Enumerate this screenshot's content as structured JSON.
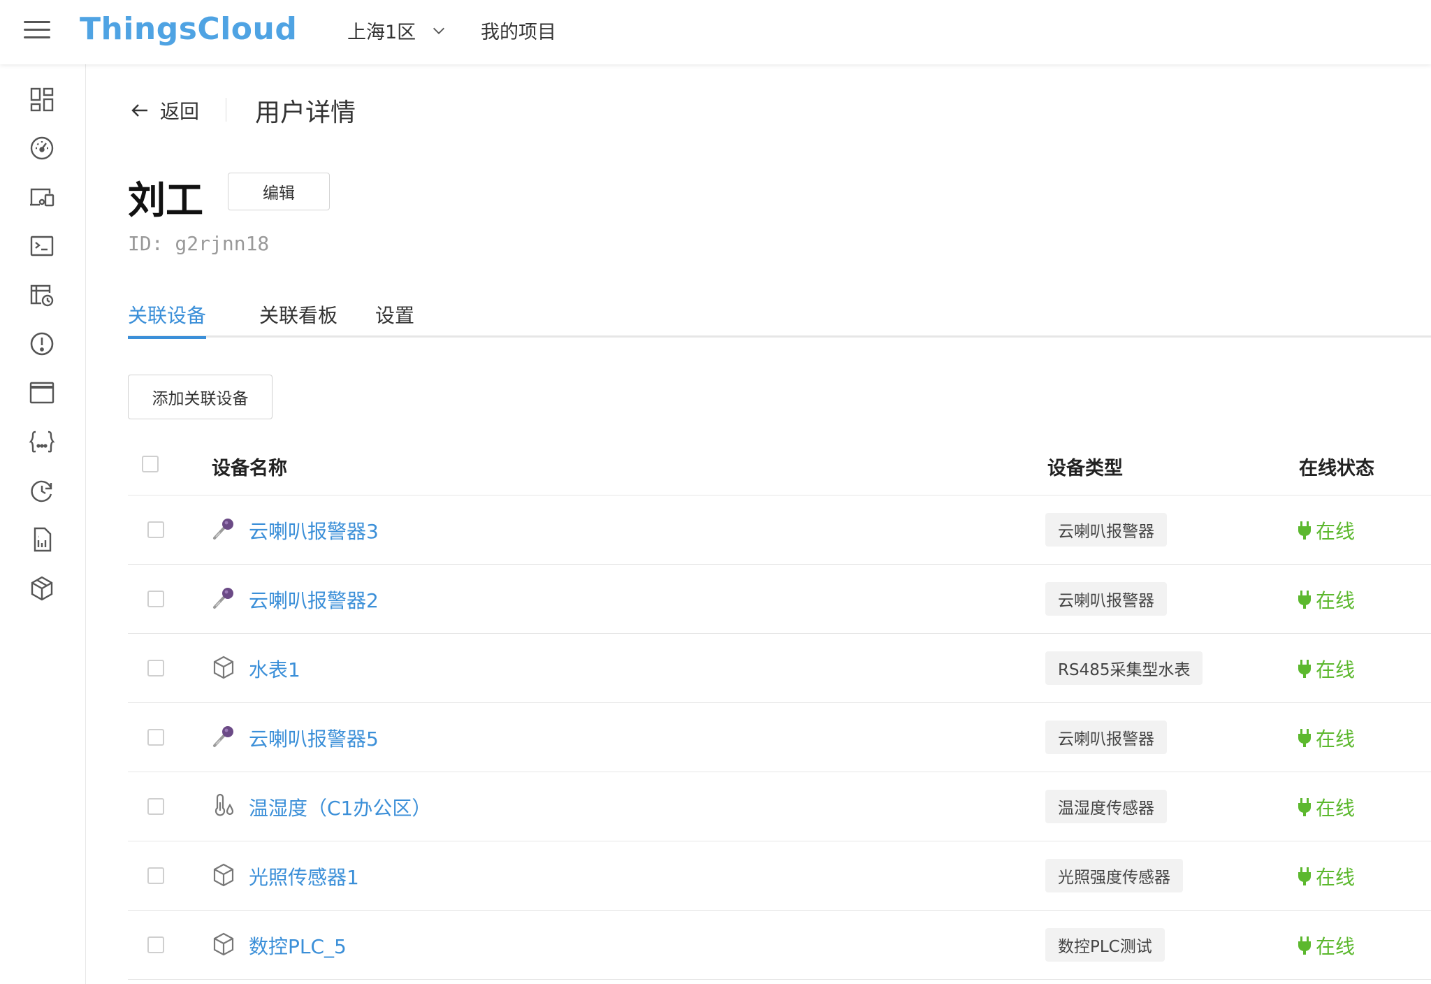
{
  "header": {
    "logo": "ThingsCloud",
    "region": "上海1区",
    "my_projects": "我的项目"
  },
  "sidebar": {
    "items": [
      {
        "icon": "dashboard-icon"
      },
      {
        "icon": "gauge-icon"
      },
      {
        "icon": "devices-icon"
      },
      {
        "icon": "terminal-icon"
      },
      {
        "icon": "schedule-icon"
      },
      {
        "icon": "alert-icon"
      },
      {
        "icon": "window-icon"
      },
      {
        "icon": "json-braces-icon"
      },
      {
        "icon": "history-icon"
      },
      {
        "icon": "sim-card-icon"
      },
      {
        "icon": "package-icon"
      }
    ]
  },
  "page": {
    "back_label": "返回",
    "title": "用户详情",
    "user_name": "刘工",
    "edit_label": "编辑",
    "user_id": "ID: g2rjnn18"
  },
  "tabs": [
    {
      "label": "关联设备",
      "active": true
    },
    {
      "label": "关联看板",
      "active": false
    },
    {
      "label": "设置",
      "active": false
    }
  ],
  "add_device_label": "添加关联设备",
  "table": {
    "columns": [
      "设备名称",
      "设备类型",
      "在线状态"
    ],
    "rows": [
      {
        "icon": "microphone-icon",
        "name": "云喇叭报警器3",
        "type": "云喇叭报警器",
        "status": "在线"
      },
      {
        "icon": "microphone-icon",
        "name": "云喇叭报警器2",
        "type": "云喇叭报警器",
        "status": "在线"
      },
      {
        "icon": "cube-icon",
        "name": "水表1",
        "type": "RS485采集型水表",
        "status": "在线"
      },
      {
        "icon": "microphone-icon",
        "name": "云喇叭报警器5",
        "type": "云喇叭报警器",
        "status": "在线"
      },
      {
        "icon": "thermometer-icon",
        "name": "温湿度（C1办公区）",
        "type": "温湿度传感器",
        "status": "在线"
      },
      {
        "icon": "cube-icon",
        "name": "光照传感器1",
        "type": "光照强度传感器",
        "status": "在线"
      },
      {
        "icon": "cube-icon",
        "name": "数控PLC_5",
        "type": "数控PLC测试",
        "status": "在线"
      }
    ]
  },
  "colors": {
    "accent": "#3b8fd8",
    "logo": "#4fa3e3",
    "online": "#5cb82e"
  }
}
